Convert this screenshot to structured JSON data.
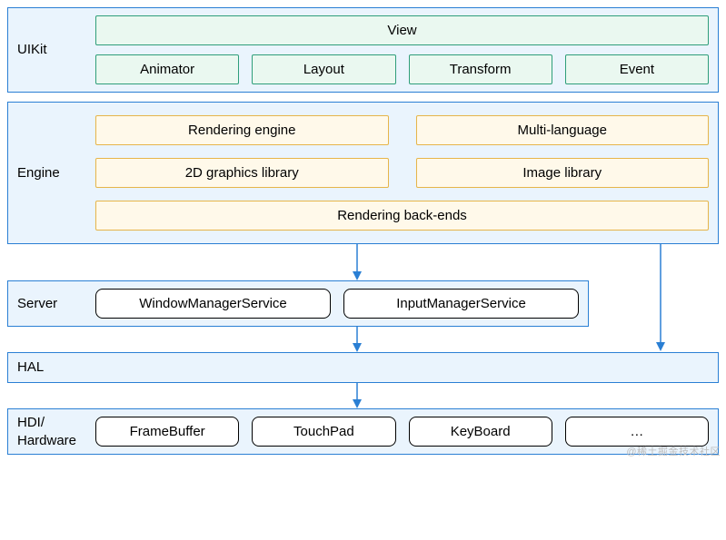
{
  "layers": {
    "uikit": {
      "label": "UIKit",
      "view": "View",
      "animator": "Animator",
      "layout": "Layout",
      "transform": "Transform",
      "event": "Event"
    },
    "engine": {
      "label": "Engine",
      "rendering_engine": "Rendering engine",
      "multi_language": "Multi-language",
      "graphics_2d": "2D graphics library",
      "image_library": "Image library",
      "rendering_backends": "Rendering back-ends"
    },
    "server": {
      "label": "Server",
      "window_mgr": "WindowManagerService",
      "input_mgr": "InputManagerService"
    },
    "hal": {
      "label": "HAL"
    },
    "hdi": {
      "label": "HDI/\nHardware",
      "framebuffer": "FrameBuffer",
      "touchpad": "TouchPad",
      "keyboard": "KeyBoard",
      "more": "…"
    }
  },
  "watermark": "@稀土掘金技术社区",
  "arrow_color": "#2a7fd4"
}
